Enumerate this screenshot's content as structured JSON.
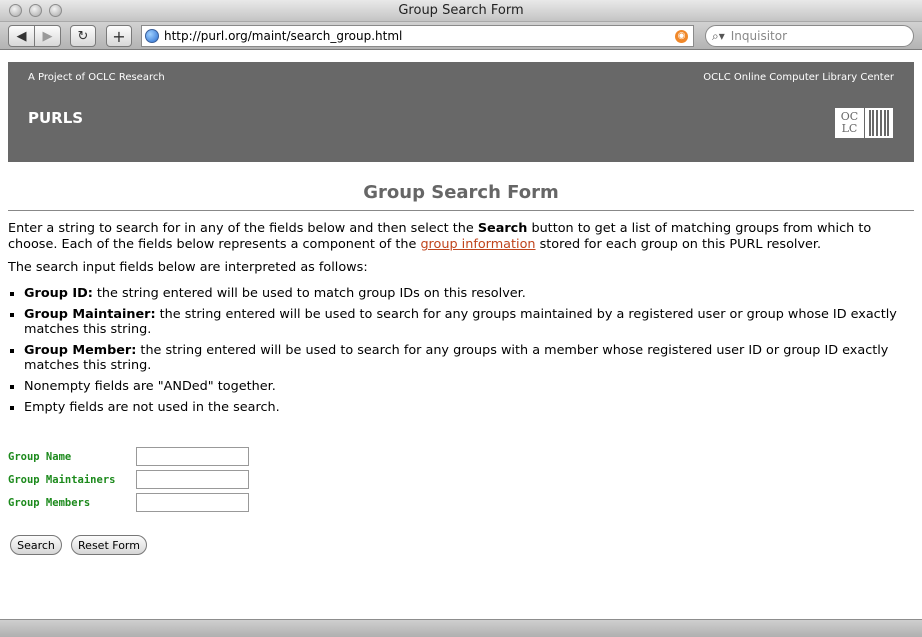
{
  "window": {
    "title": "Group Search Form"
  },
  "toolbar": {
    "back_icon": "arrow-left-icon",
    "forward_icon": "arrow-right-icon",
    "reload_icon": "reload-icon",
    "add_icon": "plus-icon",
    "address": "http://purl.org/maint/search_group.html",
    "search_placeholder": "Inquisitor"
  },
  "banner": {
    "left_text": "A Project of OCLC Research",
    "right_text": "OCLC Online Computer Library Center",
    "title": "PURLS",
    "logo_text": "OCLC",
    "background": "#686868"
  },
  "main": {
    "page_title": "Group Search Form",
    "intro": {
      "part1": "Enter a string to search for in any of the fields below and then select the ",
      "bold": "Search",
      "part2": " button to get a list of matching groups from which to choose. Each of the fields below represents a component of the ",
      "link": "group information",
      "part3": " stored for each group on this PURL resolver."
    },
    "interpretation": "The search input fields below are interpreted as follows:",
    "bullets": [
      {
        "term": "Group ID:",
        "text": " the string entered will be used to match group IDs on this resolver."
      },
      {
        "term": "Group Maintainer:",
        "text": " the string entered will be used to search for any groups maintained by a registered user or group whose ID exactly matches this string."
      },
      {
        "term": "Group Member:",
        "text": " the string entered will be used to search for any groups with a member whose registered user ID or group ID exactly matches this string."
      },
      {
        "term": "",
        "text": "Nonempty fields are \"ANDed\" together."
      },
      {
        "term": "",
        "text": "Empty fields are not used in the search."
      }
    ]
  },
  "form": {
    "fields": [
      {
        "label": "Group Name",
        "value": ""
      },
      {
        "label": "Group Maintainers",
        "value": ""
      },
      {
        "label": "Group Members",
        "value": ""
      }
    ],
    "search_label": "Search",
    "reset_label": "Reset Form",
    "label_color": "#1c8a1c"
  },
  "colors": {
    "link": "#c0441c",
    "title": "#666666"
  }
}
